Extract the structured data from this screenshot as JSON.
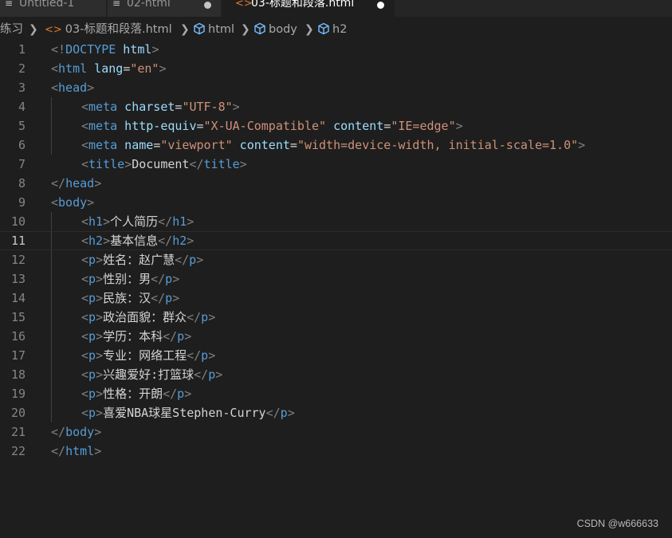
{
  "tabs": [
    {
      "label": "Untitled-1",
      "icon": "lines-icon",
      "active": false,
      "dirty": false
    },
    {
      "label": "02-html",
      "icon": "lines-icon",
      "active": false,
      "dirty": true
    },
    {
      "label": "03-标题和段落.html",
      "icon": "html-file-icon",
      "active": true,
      "dirty": true
    }
  ],
  "breadcrumb": {
    "root": "练习",
    "file": "03-标题和段落.html",
    "items": [
      "html",
      "body",
      "h2"
    ]
  },
  "editor": {
    "current_line": 11,
    "lines": [
      {
        "n": "1",
        "indent": 0,
        "tokens": [
          [
            "p",
            "<!"
          ],
          [
            "t",
            "DOCTYPE"
          ],
          [
            "a",
            " html"
          ],
          [
            "p",
            ">"
          ]
        ]
      },
      {
        "n": "2",
        "indent": 0,
        "tokens": [
          [
            "p",
            "<"
          ],
          [
            "t",
            "html"
          ],
          [
            "a",
            " lang"
          ],
          [
            "x",
            "="
          ],
          [
            "s",
            "\"en\""
          ],
          [
            "p",
            ">"
          ]
        ]
      },
      {
        "n": "3",
        "indent": 0,
        "tokens": [
          [
            "p",
            "<"
          ],
          [
            "t",
            "head"
          ],
          [
            "p",
            ">"
          ]
        ]
      },
      {
        "n": "4",
        "indent": 1,
        "tokens": [
          [
            "p",
            "<"
          ],
          [
            "t",
            "meta"
          ],
          [
            "a",
            " charset"
          ],
          [
            "x",
            "="
          ],
          [
            "s",
            "\"UTF-8\""
          ],
          [
            "p",
            ">"
          ]
        ]
      },
      {
        "n": "5",
        "indent": 1,
        "tokens": [
          [
            "p",
            "<"
          ],
          [
            "t",
            "meta"
          ],
          [
            "a",
            " http-equiv"
          ],
          [
            "x",
            "="
          ],
          [
            "s",
            "\"X-UA-Compatible\""
          ],
          [
            "a",
            " content"
          ],
          [
            "x",
            "="
          ],
          [
            "s",
            "\"IE=edge\""
          ],
          [
            "p",
            ">"
          ]
        ]
      },
      {
        "n": "6",
        "indent": 1,
        "tokens": [
          [
            "p",
            "<"
          ],
          [
            "t",
            "meta"
          ],
          [
            "a",
            " name"
          ],
          [
            "x",
            "="
          ],
          [
            "s",
            "\"viewport\""
          ],
          [
            "a",
            " content"
          ],
          [
            "x",
            "="
          ],
          [
            "s",
            "\"width=device-width, initial-scale=1.0\""
          ],
          [
            "p",
            ">"
          ]
        ]
      },
      {
        "n": "7",
        "indent": 1,
        "tokens": [
          [
            "p",
            "<"
          ],
          [
            "t",
            "title"
          ],
          [
            "p",
            ">"
          ],
          [
            "x",
            "Document"
          ],
          [
            "p",
            "</"
          ],
          [
            "t",
            "title"
          ],
          [
            "p",
            ">"
          ]
        ]
      },
      {
        "n": "8",
        "indent": 0,
        "tokens": [
          [
            "p",
            "</"
          ],
          [
            "t",
            "head"
          ],
          [
            "p",
            ">"
          ]
        ]
      },
      {
        "n": "9",
        "indent": 0,
        "tokens": [
          [
            "p",
            "<"
          ],
          [
            "t",
            "body"
          ],
          [
            "p",
            ">"
          ]
        ]
      },
      {
        "n": "10",
        "indent": 1,
        "tokens": [
          [
            "p",
            "<"
          ],
          [
            "t",
            "h1"
          ],
          [
            "p",
            ">"
          ],
          [
            "x",
            "个人简历"
          ],
          [
            "p",
            "</"
          ],
          [
            "t",
            "h1"
          ],
          [
            "p",
            ">"
          ]
        ]
      },
      {
        "n": "11",
        "indent": 1,
        "tokens": [
          [
            "p",
            "<"
          ],
          [
            "t",
            "h2"
          ],
          [
            "p",
            ">"
          ],
          [
            "x",
            "基本信息"
          ],
          [
            "p",
            "</"
          ],
          [
            "t",
            "h2"
          ],
          [
            "p",
            ">"
          ]
        ]
      },
      {
        "n": "12",
        "indent": 1,
        "tokens": [
          [
            "p",
            "<"
          ],
          [
            "t",
            "p"
          ],
          [
            "p",
            ">"
          ],
          [
            "x",
            "姓名：赵广慧"
          ],
          [
            "p",
            "</"
          ],
          [
            "t",
            "p"
          ],
          [
            "p",
            ">"
          ]
        ]
      },
      {
        "n": "13",
        "indent": 1,
        "tokens": [
          [
            "p",
            "<"
          ],
          [
            "t",
            "p"
          ],
          [
            "p",
            ">"
          ],
          [
            "x",
            "性别：男"
          ],
          [
            "p",
            "</"
          ],
          [
            "t",
            "p"
          ],
          [
            "p",
            ">"
          ]
        ]
      },
      {
        "n": "14",
        "indent": 1,
        "tokens": [
          [
            "p",
            "<"
          ],
          [
            "t",
            "p"
          ],
          [
            "p",
            ">"
          ],
          [
            "x",
            "民族：汉"
          ],
          [
            "p",
            "</"
          ],
          [
            "t",
            "p"
          ],
          [
            "p",
            ">"
          ]
        ]
      },
      {
        "n": "15",
        "indent": 1,
        "tokens": [
          [
            "p",
            "<"
          ],
          [
            "t",
            "p"
          ],
          [
            "p",
            ">"
          ],
          [
            "x",
            "政治面貌：群众"
          ],
          [
            "p",
            "</"
          ],
          [
            "t",
            "p"
          ],
          [
            "p",
            ">"
          ]
        ]
      },
      {
        "n": "16",
        "indent": 1,
        "tokens": [
          [
            "p",
            "<"
          ],
          [
            "t",
            "p"
          ],
          [
            "p",
            ">"
          ],
          [
            "x",
            "学历：本科"
          ],
          [
            "p",
            "</"
          ],
          [
            "t",
            "p"
          ],
          [
            "p",
            ">"
          ]
        ]
      },
      {
        "n": "17",
        "indent": 1,
        "tokens": [
          [
            "p",
            "<"
          ],
          [
            "t",
            "p"
          ],
          [
            "p",
            ">"
          ],
          [
            "x",
            "专业：网络工程"
          ],
          [
            "p",
            "</"
          ],
          [
            "t",
            "p"
          ],
          [
            "p",
            ">"
          ]
        ]
      },
      {
        "n": "18",
        "indent": 1,
        "tokens": [
          [
            "p",
            "<"
          ],
          [
            "t",
            "p"
          ],
          [
            "p",
            ">"
          ],
          [
            "x",
            "兴趣爱好:打篮球"
          ],
          [
            "p",
            "</"
          ],
          [
            "t",
            "p"
          ],
          [
            "p",
            ">"
          ]
        ]
      },
      {
        "n": "19",
        "indent": 1,
        "tokens": [
          [
            "p",
            "<"
          ],
          [
            "t",
            "p"
          ],
          [
            "p",
            ">"
          ],
          [
            "x",
            "性格：开朗"
          ],
          [
            "p",
            "</"
          ],
          [
            "t",
            "p"
          ],
          [
            "p",
            ">"
          ]
        ]
      },
      {
        "n": "20",
        "indent": 1,
        "tokens": [
          [
            "p",
            "<"
          ],
          [
            "t",
            "p"
          ],
          [
            "p",
            ">"
          ],
          [
            "x",
            "喜爱NBA球星Stephen-Curry"
          ],
          [
            "p",
            "</"
          ],
          [
            "t",
            "p"
          ],
          [
            "p",
            ">"
          ]
        ]
      },
      {
        "n": "21",
        "indent": 0,
        "tokens": [
          [
            "p",
            "</"
          ],
          [
            "t",
            "body"
          ],
          [
            "p",
            ">"
          ]
        ]
      },
      {
        "n": "22",
        "indent": 0,
        "tokens": [
          [
            "p",
            "</"
          ],
          [
            "t",
            "html"
          ],
          [
            "p",
            ">"
          ]
        ]
      }
    ]
  },
  "watermark": "CSDN @w666633",
  "colors": {
    "background": "#1e1e1e",
    "tag": "#569cd6",
    "attribute": "#9cdcfe",
    "string": "#ce9178",
    "punctuation": "#808080",
    "html_icon": "#e37933"
  }
}
